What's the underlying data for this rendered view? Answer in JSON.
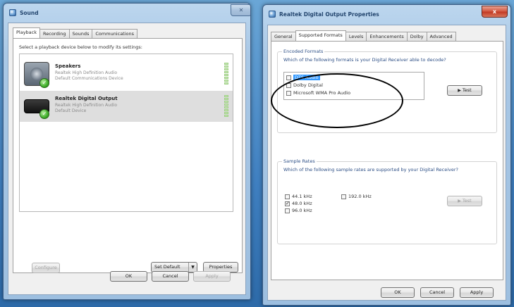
{
  "sound_window": {
    "title": "Sound",
    "tabs": [
      "Playback",
      "Recording",
      "Sounds",
      "Communications"
    ],
    "instruction": "Select a playback device below to modify its settings:",
    "devices": [
      {
        "name": "Speakers",
        "line1": "Realtek High Definition Audio",
        "line2": "Default Communications Device",
        "selected": false,
        "icon": "speaker-icon"
      },
      {
        "name": "Realtek Digital Output",
        "line1": "Realtek High Definition Audio",
        "line2": "Default Device",
        "selected": true,
        "icon": "digital-output-icon"
      }
    ],
    "configure_label": "Configure",
    "set_default_label": "Set Default",
    "properties_label": "Properties",
    "ok_label": "OK",
    "cancel_label": "Cancel",
    "apply_label": "Apply"
  },
  "props_window": {
    "title": "Realtek Digital Output Properties",
    "close_label": "x",
    "tabs": [
      "General",
      "Supported Formats",
      "Levels",
      "Enhancements",
      "Dolby",
      "Advanced"
    ],
    "encoded_formats": {
      "label": "Encoded Formats",
      "description": "Which of the following formats is your Digital Receiver able to decode?",
      "items": [
        {
          "label": "DTS Audio",
          "checked": false,
          "highlighted": true
        },
        {
          "label": "Dolby Digital",
          "checked": false,
          "highlighted": false
        },
        {
          "label": "Microsoft WMA Pro Audio",
          "checked": false,
          "highlighted": false
        }
      ],
      "test_label": "Test"
    },
    "sample_rates": {
      "label": "Sample Rates",
      "description": "Which of the following sample rates are supported by your Digital Receiver?",
      "items": [
        {
          "label": "44.1 kHz",
          "checked": false
        },
        {
          "label": "48.0 kHz",
          "checked": true
        },
        {
          "label": "96.0 kHz",
          "checked": false
        },
        {
          "label": "192.0 kHz",
          "checked": false
        }
      ],
      "test_label": "Test"
    },
    "ok_label": "OK",
    "cancel_label": "Cancel",
    "apply_label": "Apply"
  }
}
